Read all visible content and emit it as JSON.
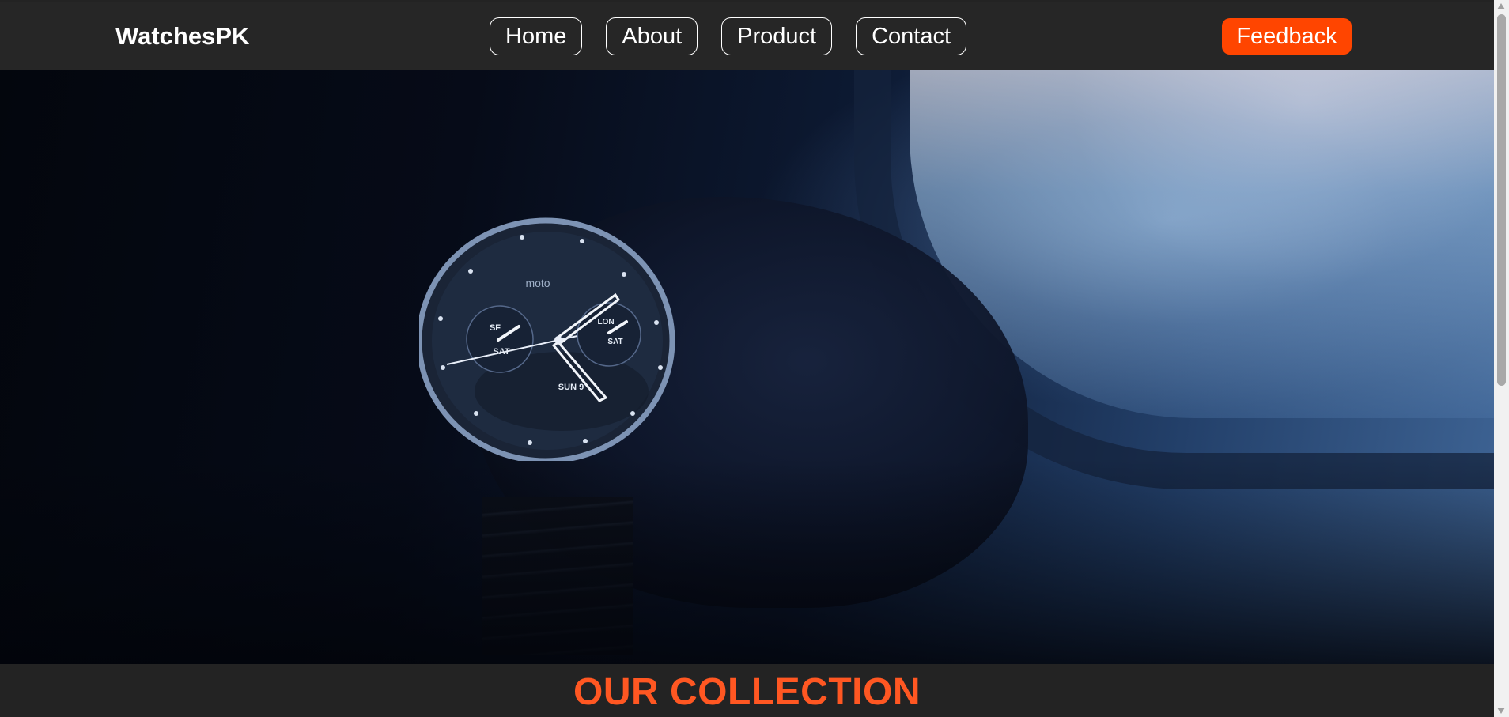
{
  "navbar": {
    "brand": "WatchesPK",
    "links": [
      "Home",
      "About",
      "Product",
      "Contact"
    ],
    "feedback_label": "Feedback"
  },
  "hero": {
    "image_alt": "hero-watch-image",
    "watch_face": {
      "logo": "moto",
      "left_dial_top": "SF",
      "left_dial_bottom": "SAT",
      "right_dial_top": "LON",
      "right_dial_bottom": "SAT",
      "date": "SUN 9"
    }
  },
  "collection": {
    "title": "OUR COLLECTION"
  },
  "colors": {
    "navbar_bg": "#262626",
    "accent": "#ff4500",
    "title_accent": "#ff5722"
  }
}
